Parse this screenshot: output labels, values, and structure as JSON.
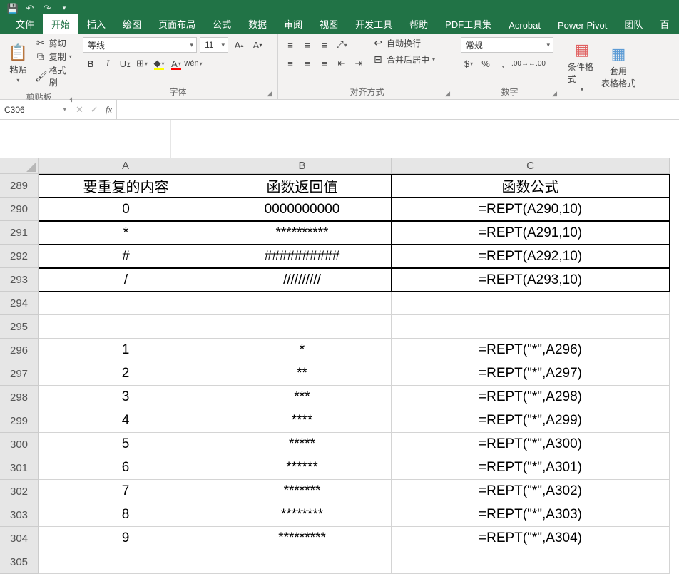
{
  "qat": {
    "save": "💾",
    "undo": "↶",
    "redo": "↷",
    "more": "▾"
  },
  "tabs": [
    "文件",
    "开始",
    "插入",
    "绘图",
    "页面布局",
    "公式",
    "数据",
    "审阅",
    "视图",
    "开发工具",
    "帮助",
    "PDF工具集",
    "Acrobat",
    "Power Pivot",
    "团队",
    "百"
  ],
  "active_tab_index": 1,
  "ribbon": {
    "clipboard": {
      "paste": "粘贴",
      "cut": "剪切",
      "copy": "复制",
      "painter": "格式刷",
      "label": "剪贴板"
    },
    "font": {
      "name": "等线",
      "size": "11",
      "label": "字体",
      "bold": "B",
      "italic": "I",
      "underline": "U"
    },
    "align": {
      "wrap": "自动换行",
      "merge": "合并后居中",
      "label": "对齐方式"
    },
    "number": {
      "format": "常规",
      "label": "数字"
    },
    "styles": {
      "cond": "条件格式",
      "table": "套用\n表格格式"
    }
  },
  "namebox": "C306",
  "formula": "",
  "columns": [
    "A",
    "B",
    "C"
  ],
  "rows": [
    {
      "n": 289,
      "a": "要重复的内容",
      "b": "函数返回值",
      "c": "函数公式",
      "box": true,
      "hdr": true
    },
    {
      "n": 290,
      "a": "0",
      "b": "0000000000",
      "c": "=REPT(A290,10)",
      "box": true
    },
    {
      "n": 291,
      "a": "*",
      "b": "**********",
      "c": "=REPT(A291,10)",
      "box": true
    },
    {
      "n": 292,
      "a": "#",
      "b": "##########",
      "c": "=REPT(A292,10)",
      "box": true
    },
    {
      "n": 293,
      "a": "/",
      "b": "//////////",
      "c": "=REPT(A293,10)",
      "box": true
    },
    {
      "n": 294,
      "a": "",
      "b": "",
      "c": "",
      "box": false
    },
    {
      "n": 295,
      "a": "",
      "b": "",
      "c": "",
      "box": false
    },
    {
      "n": 296,
      "a": "1",
      "b": "*",
      "c": "=REPT(\"*\",A296)",
      "box": false
    },
    {
      "n": 297,
      "a": "2",
      "b": "**",
      "c": "=REPT(\"*\",A297)",
      "box": false
    },
    {
      "n": 298,
      "a": "3",
      "b": "***",
      "c": "=REPT(\"*\",A298)",
      "box": false
    },
    {
      "n": 299,
      "a": "4",
      "b": "****",
      "c": "=REPT(\"*\",A299)",
      "box": false
    },
    {
      "n": 300,
      "a": "5",
      "b": "*****",
      "c": "=REPT(\"*\",A300)",
      "box": false
    },
    {
      "n": 301,
      "a": "6",
      "b": "******",
      "c": "=REPT(\"*\",A301)",
      "box": false
    },
    {
      "n": 302,
      "a": "7",
      "b": "*******",
      "c": "=REPT(\"*\",A302)",
      "box": false
    },
    {
      "n": 303,
      "a": "8",
      "b": "********",
      "c": "=REPT(\"*\",A303)",
      "box": false
    },
    {
      "n": 304,
      "a": "9",
      "b": "*********",
      "c": "=REPT(\"*\",A304)",
      "box": false
    },
    {
      "n": 305,
      "a": "",
      "b": "",
      "c": "",
      "box": false
    }
  ]
}
